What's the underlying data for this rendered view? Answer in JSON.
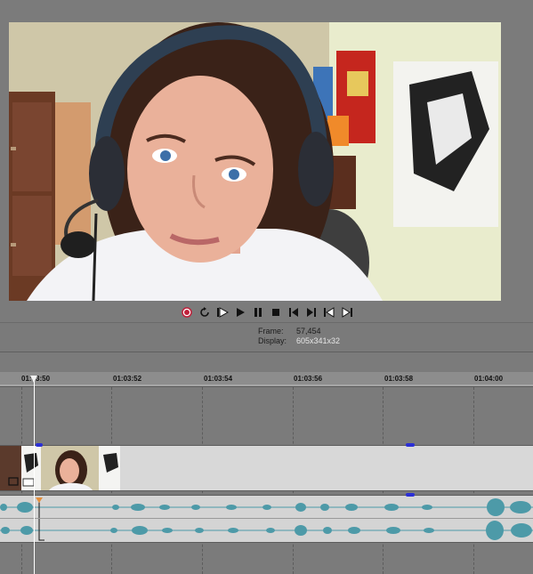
{
  "transport": {
    "buttons": [
      "record",
      "loop",
      "play-from-start",
      "play",
      "pause",
      "stop",
      "go-to-start",
      "go-to-end",
      "previous-frame",
      "next-frame"
    ]
  },
  "info": {
    "frame_label": "Frame:",
    "frame_value": "57,454",
    "display_label": "Display:",
    "display_value": "605x341x32"
  },
  "timeline": {
    "ruler_labels": [
      "01:03:50",
      "01:03:52",
      "01:03:54",
      "01:03:56",
      "01:03:58",
      "01:04:00"
    ]
  },
  "colors": {
    "background": "#7a7a7a",
    "waveform": "#4d9aa8",
    "record_red": "#c0203a",
    "marker_blue": "#2b2fd6",
    "track_bg": "#d8d8d8"
  }
}
